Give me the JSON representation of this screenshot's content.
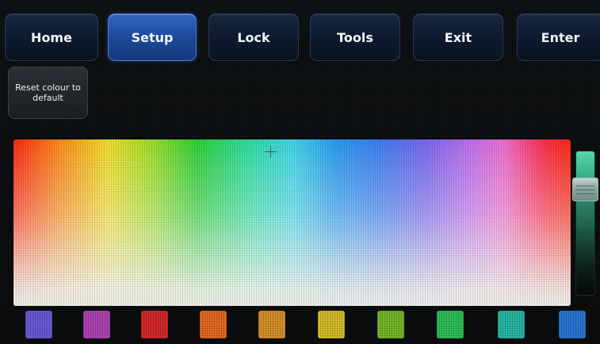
{
  "nav": {
    "home": "Home",
    "setup": "Setup",
    "lock": "Lock",
    "tools": "Tools",
    "exit": "Exit",
    "enter": "Enter",
    "active": "Setup"
  },
  "reset_button": "Reset colour to default",
  "icons": {
    "crosshair": "crosshair-icon"
  },
  "swatches": [
    {
      "color": "#6a5cd8"
    },
    {
      "color": "#b044b4"
    },
    {
      "color": "#d82a2a"
    },
    {
      "color": "#e86a22"
    },
    {
      "color": "#d8942a"
    },
    {
      "color": "#d8c02a"
    },
    {
      "color": "#78b82a"
    },
    {
      "color": "#2ec25a"
    },
    {
      "color": "#2ab8a8"
    },
    {
      "color": "#2a78d8"
    }
  ]
}
